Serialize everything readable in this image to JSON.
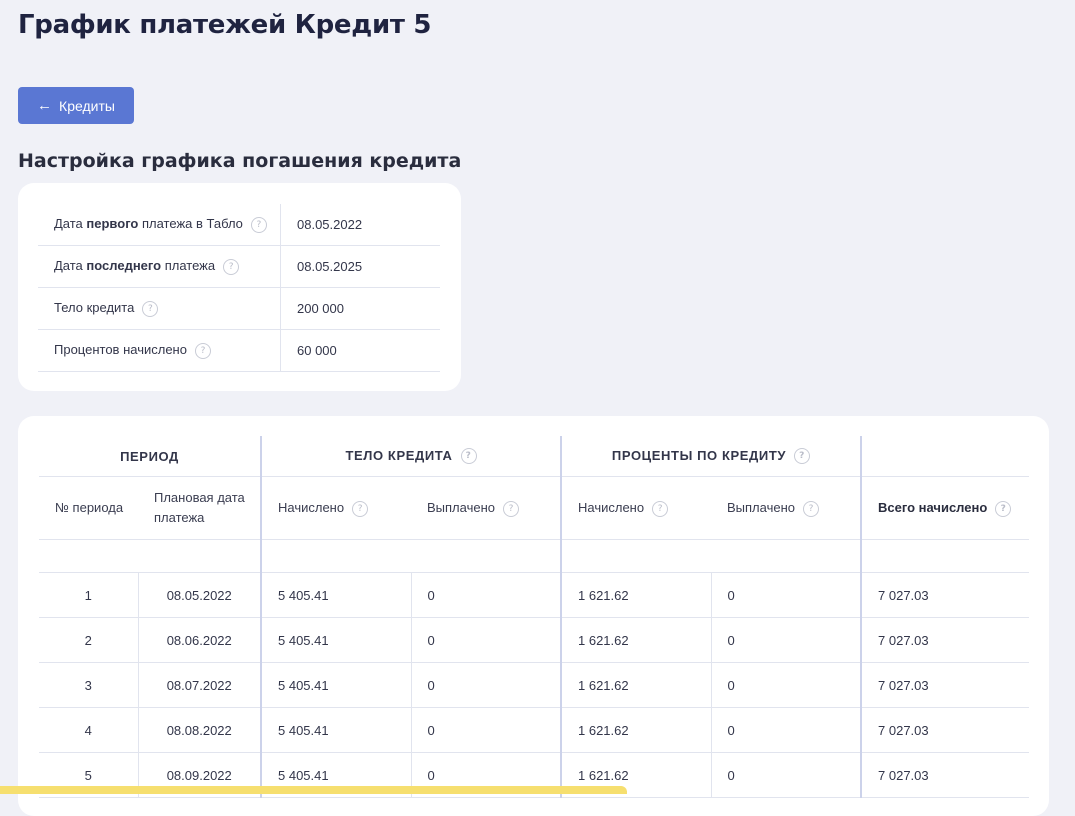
{
  "page": {
    "title": "График платежей Кредит 5"
  },
  "back_button": {
    "arrow": "←",
    "label": "Кредиты"
  },
  "settings": {
    "title": "Настройка графика погашения кредита",
    "rows": [
      {
        "label_pre": "Дата ",
        "label_bold": "первого",
        "label_post": " платежа в Табло",
        "value": "08.05.2022"
      },
      {
        "label_pre": "Дата ",
        "label_bold": "последнего",
        "label_post": " платежа",
        "value": "08.05.2025"
      },
      {
        "label_pre": "Тело кредита",
        "label_bold": "",
        "label_post": "",
        "value": "200 000"
      },
      {
        "label_pre": "Процентов начислено",
        "label_bold": "",
        "label_post": "",
        "value": "60 000"
      }
    ]
  },
  "icons": {
    "help": "question-circle-icon",
    "help_glyph": "?"
  },
  "schedule": {
    "groups": {
      "period": "ПЕРИОД",
      "body": "ТЕЛО КРЕДИТА",
      "interest": "ПРОЦЕНТЫ ПО КРЕДИТУ"
    },
    "columns": {
      "period_no": "№ периода",
      "plan_date_1": "Плановая дата",
      "plan_date_2": "платежа",
      "body_accrued": "Начислено",
      "body_paid": "Выплачено",
      "interest_accrued": "Начислено",
      "interest_paid": "Выплачено",
      "total_accrued": "Всего начислено"
    },
    "rows": [
      {
        "no": "1",
        "date": "08.05.2022",
        "body_accrued": "5 405.41",
        "body_paid": "0",
        "interest_accrued": "1 621.62",
        "interest_paid": "0",
        "total": "7 027.03"
      },
      {
        "no": "2",
        "date": "08.06.2022",
        "body_accrued": "5 405.41",
        "body_paid": "0",
        "interest_accrued": "1 621.62",
        "interest_paid": "0",
        "total": "7 027.03"
      },
      {
        "no": "3",
        "date": "08.07.2022",
        "body_accrued": "5 405.41",
        "body_paid": "0",
        "interest_accrued": "1 621.62",
        "interest_paid": "0",
        "total": "7 027.03"
      },
      {
        "no": "4",
        "date": "08.08.2022",
        "body_accrued": "5 405.41",
        "body_paid": "0",
        "interest_accrued": "1 621.62",
        "interest_paid": "0",
        "total": "7 027.03"
      },
      {
        "no": "5",
        "date": "08.09.2022",
        "body_accrued": "5 405.41",
        "body_paid": "0",
        "interest_accrued": "1 621.62",
        "interest_paid": "0",
        "total": "7 027.03"
      }
    ]
  },
  "colors": {
    "background": "#f0f1f7",
    "accent": "#5a77d3",
    "bottom_bar": "#f6df6f"
  }
}
